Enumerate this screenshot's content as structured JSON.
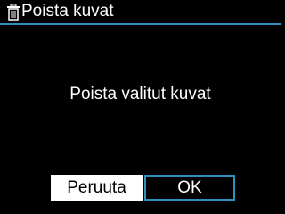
{
  "colors": {
    "background": "#000000",
    "text": "#ffffff",
    "accent": "#2f8fbf",
    "cancel_button_bg": "#ffffff",
    "cancel_button_text": "#000000"
  },
  "header": {
    "icon": "trash-icon",
    "title": "Poista kuvat"
  },
  "dialog": {
    "message": "Poista valitut kuvat"
  },
  "buttons": {
    "cancel_label": "Peruuta",
    "ok_label": "OK",
    "selected": "OK"
  }
}
